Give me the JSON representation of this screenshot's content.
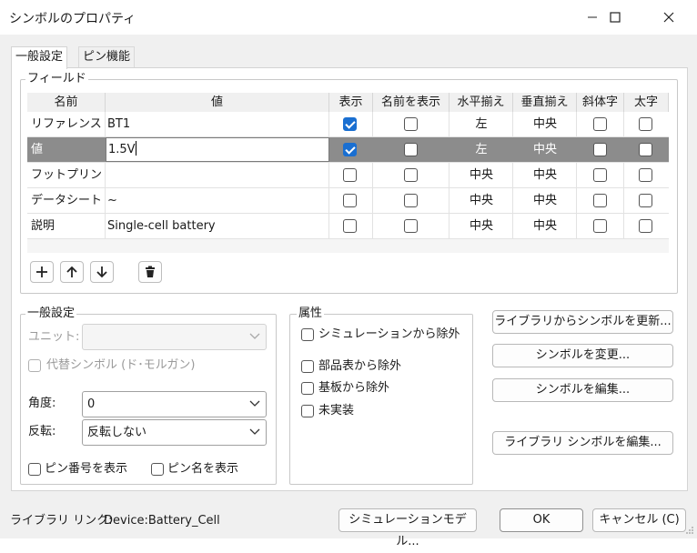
{
  "window": {
    "title": "シンボルのプロパティ"
  },
  "tabs": [
    {
      "label": "一般設定"
    },
    {
      "label": "ピン機能"
    }
  ],
  "fields": {
    "title": "フィールド",
    "columns": [
      "名前",
      "値",
      "表示",
      "名前を表示",
      "水平揃え",
      "垂直揃え",
      "斜体字",
      "太字"
    ],
    "rows": [
      {
        "name": "リファレンス",
        "value": "BT1",
        "show": true,
        "show_name": false,
        "h_align": "左",
        "v_align": "中央",
        "italic": false,
        "bold": false
      },
      {
        "name": "値",
        "value": "1.5V",
        "show": true,
        "show_name": false,
        "h_align": "左",
        "v_align": "中央",
        "italic": false,
        "bold": false,
        "selected": true,
        "editing": true
      },
      {
        "name": "フットプリント",
        "value": "",
        "show": false,
        "show_name": false,
        "h_align": "中央",
        "v_align": "中央",
        "italic": false,
        "bold": false
      },
      {
        "name": "データシート",
        "value": "~",
        "show": false,
        "show_name": false,
        "h_align": "中央",
        "v_align": "中央",
        "italic": false,
        "bold": false
      },
      {
        "name": "説明",
        "value": "Single-cell battery",
        "show": false,
        "show_name": false,
        "h_align": "中央",
        "v_align": "中央",
        "italic": false,
        "bold": false
      }
    ]
  },
  "general": {
    "title": "一般設定",
    "unit_label": "ユニット:",
    "unit_value": "",
    "alt_symbol_label": "代替シンボル (ド･モルガン)",
    "angle_label": "角度:",
    "angle_value": "0",
    "mirror_label": "反転:",
    "mirror_value": "反転しない",
    "show_pin_numbers": "ピン番号を表示",
    "show_pin_names": "ピン名を表示"
  },
  "attributes": {
    "title": "属性",
    "exclude_sim": "シミュレーションから除外",
    "exclude_bom": "部品表から除外",
    "exclude_board": "基板から除外",
    "dnp": "未実装"
  },
  "actions": {
    "update_from_lib": "ライブラリからシンボルを更新...",
    "change_symbol": "シンボルを変更...",
    "edit_symbol": "シンボルを編集...",
    "edit_lib_symbol": "ライブラリ シンボルを編集..."
  },
  "footer": {
    "library_link_label": "ライブラリ リンク:",
    "library_link_value": "Device:Battery_Cell",
    "sim_model": "シミュレーションモデル...",
    "ok": "OK",
    "cancel": "キャンセル (C)"
  },
  "colors": {
    "check_accent": "#1a6fd1",
    "selected_row": "#8c8c8c"
  }
}
